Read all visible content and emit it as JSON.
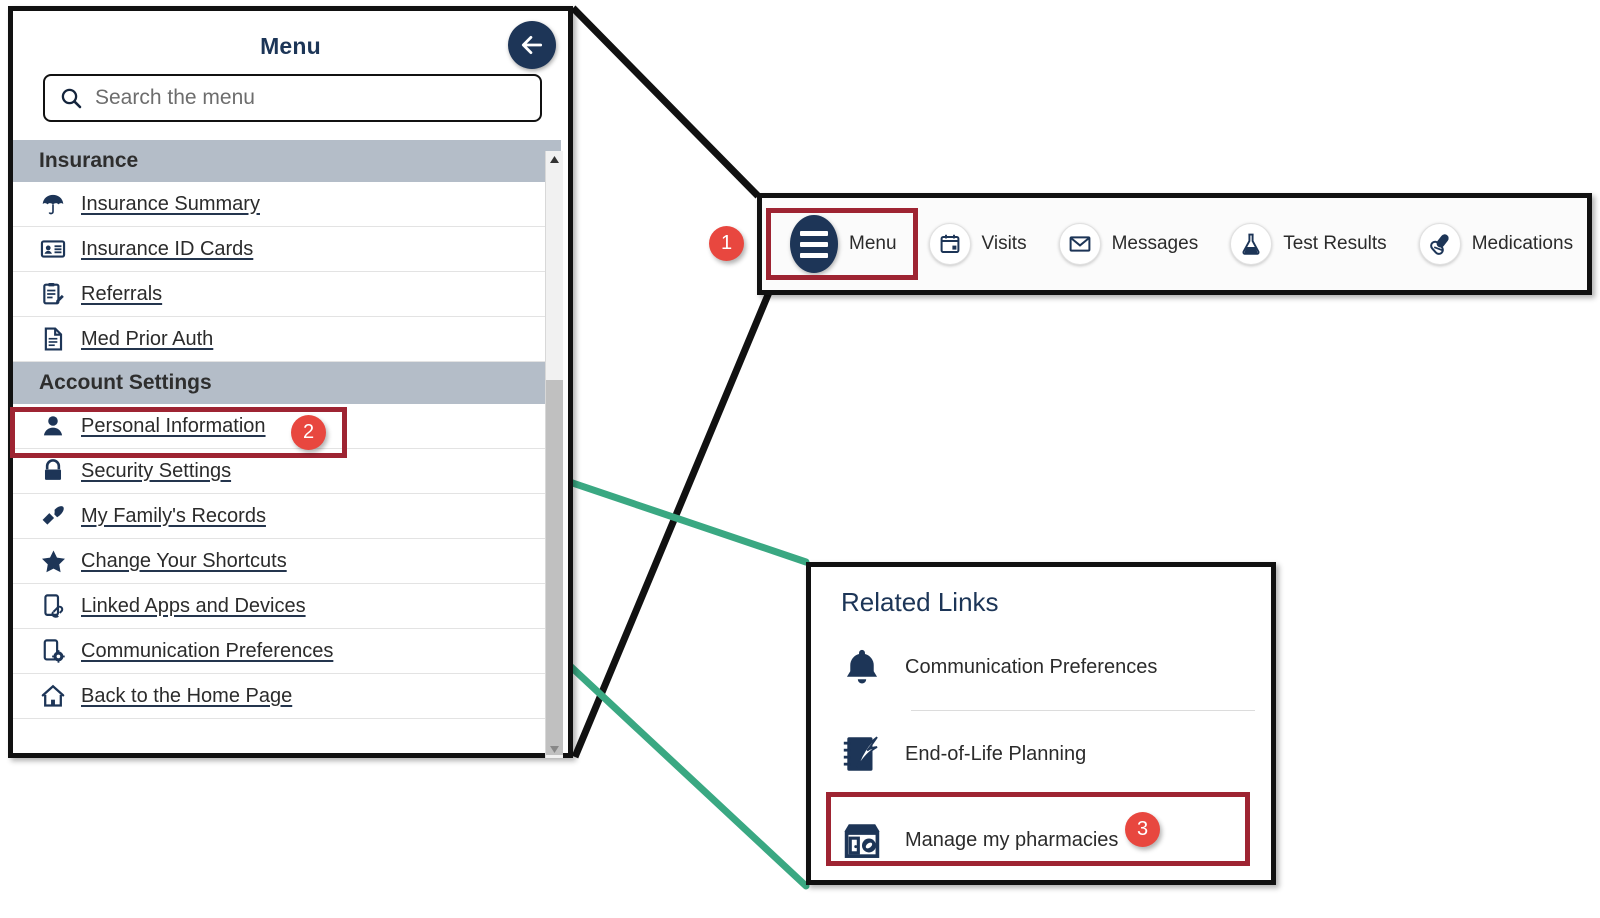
{
  "colors": {
    "navy": "#1d3557",
    "badge_red": "#e8473f",
    "highlight_red": "#9e2432",
    "section_header_bg": "#b4bdc8",
    "connector_green": "#3aa882",
    "connector_black": "#111111"
  },
  "menu_panel": {
    "title": "Menu",
    "back_icon": "arrow-left-icon",
    "search": {
      "icon": "search-icon",
      "placeholder": "Search the menu",
      "value": ""
    },
    "sections": [
      {
        "header": "Insurance",
        "items": [
          {
            "label": "Insurance Summary",
            "icon": "umbrella-icon"
          },
          {
            "label": "Insurance ID Cards",
            "icon": "id-card-icon"
          },
          {
            "label": "Referrals",
            "icon": "clipboard-pencil-icon"
          },
          {
            "label": "Med Prior Auth",
            "icon": "document-icon"
          }
        ]
      },
      {
        "header": "Account Settings",
        "items": [
          {
            "label": "Personal Information",
            "icon": "person-icon"
          },
          {
            "label": "Security Settings",
            "icon": "lock-icon"
          },
          {
            "label": "My Family's Records",
            "icon": "paintbrush-icon"
          },
          {
            "label": "Change Your Shortcuts",
            "icon": "star-icon"
          },
          {
            "label": "Linked Apps and Devices",
            "icon": "phone-link-icon"
          },
          {
            "label": "Communication Preferences",
            "icon": "phone-gear-icon"
          },
          {
            "label": "Back to the Home Page",
            "icon": "home-icon"
          }
        ]
      }
    ],
    "scrollbar": {
      "up_icon": "caret-up-icon",
      "down_icon": "caret-down-icon"
    }
  },
  "nav_bar": {
    "items": [
      {
        "label": "Menu",
        "icon": "hamburger-icon"
      },
      {
        "label": "Visits",
        "icon": "calendar-icon"
      },
      {
        "label": "Messages",
        "icon": "envelope-icon"
      },
      {
        "label": "Test Results",
        "icon": "flask-icon"
      },
      {
        "label": "Medications",
        "icon": "pills-icon"
      }
    ]
  },
  "related_links": {
    "title": "Related Links",
    "items": [
      {
        "label": "Communication Preferences",
        "icon": "bell-icon"
      },
      {
        "label": "End-of-Life Planning",
        "icon": "notebook-quill-icon"
      },
      {
        "label": "Manage my pharmacies",
        "icon": "pharmacy-storefront-icon"
      }
    ]
  },
  "callout_badges": [
    {
      "number": "1",
      "target": "nav-menu-button"
    },
    {
      "number": "2",
      "target": "menu-item-personal-information"
    },
    {
      "number": "3",
      "target": "related-link-manage-my-pharmacies"
    }
  ]
}
